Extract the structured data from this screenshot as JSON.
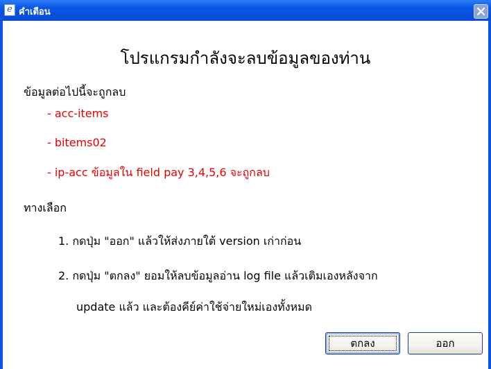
{
  "window": {
    "title": "คำเตือน",
    "icon": "document-e-icon",
    "close_icon": "close-icon"
  },
  "dialog": {
    "heading": "โปรแกรมกำลังจะลบข้อมูลของท่าน",
    "intro": "ข้อมูลต่อไปนี้จะถูกลบ",
    "items": [
      "- acc-items",
      "- bitems02",
      "- ip-acc ข้อมูลใน field pay 3,4,5,6 จะถูกลบ"
    ],
    "options_label": "ทางเลือก",
    "options": [
      "1. กดปุ่ม \"ออก\" แล้วให้ส่งภายใต้ version เก่าก่อน",
      "2. กดปุ่ม \"ตกลง\" ยอมให้ลบข้อมูลอ่าน log file แล้วเติมเองหลังจาก",
      "update แล้ว และต้องคีย์ค่าใช้จ่ายใหม่เองทั้งหมด"
    ]
  },
  "buttons": {
    "ok_label": "ตกลง",
    "exit_label": "ออก"
  },
  "colors": {
    "titlebar": "#0b58e8",
    "warning_text": "#e60000"
  }
}
